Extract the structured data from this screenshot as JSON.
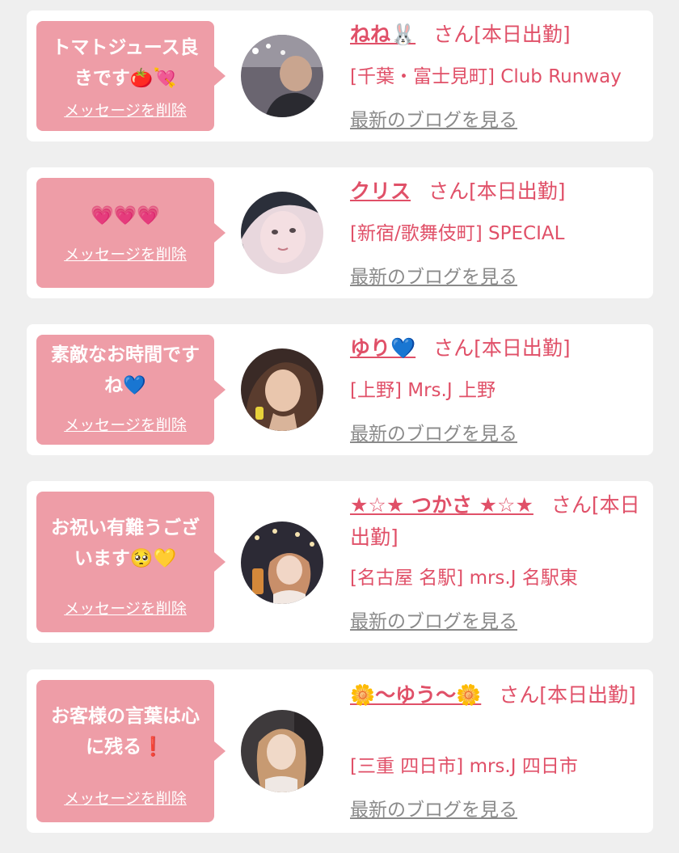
{
  "delete_label": "メッセージを削除",
  "honorific": "さん[本日出勤]",
  "blog_label": "最新のブログを見る",
  "colors": {
    "background": "#efefef",
    "card": "#ffffff",
    "bubble": "#ee9da7",
    "name": "#e05068",
    "shop": "#e05068",
    "blog_link": "#8a8a8a"
  },
  "cards": [
    {
      "message_lines": [
        "トマトジュース良",
        "きです🍅💘"
      ],
      "name": "ねね🐰",
      "shop": "[千葉・富士見町] Club Runway"
    },
    {
      "message_lines": [
        "💗💗💗"
      ],
      "name": "クリス",
      "shop": "[新宿/歌舞伎町] SPECIAL"
    },
    {
      "message_lines": [
        "素敵なお時間です",
        "ね💙"
      ],
      "name": "ゆり💙",
      "shop": "[上野] Mrs.J 上野"
    },
    {
      "message_lines": [
        "お祝い有難うござ",
        "います🥺💛"
      ],
      "name": "★☆★ つかさ ★☆★",
      "shop": "[名古屋 名駅] mrs.J 名駅東"
    },
    {
      "message_lines": [
        "お客様の言葉は心",
        "に残る❗"
      ],
      "name": "🌼〜ゆう〜🌼",
      "shop": "[三重 四日市] mrs.J 四日市"
    }
  ]
}
